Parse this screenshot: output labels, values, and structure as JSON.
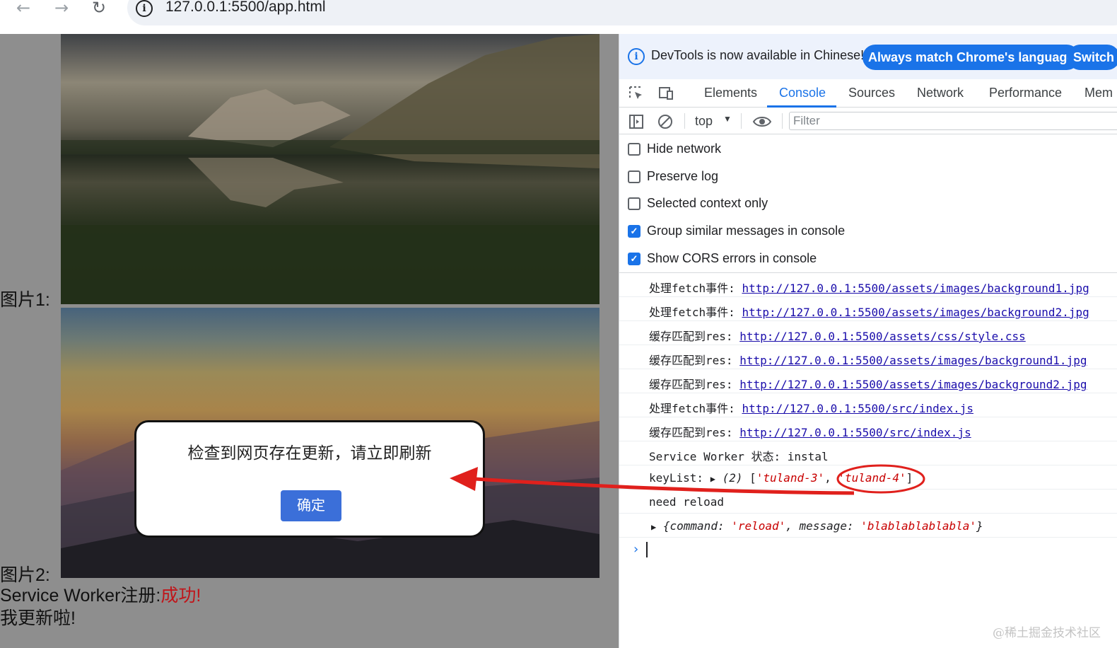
{
  "browser": {
    "url": "127.0.0.1:5500/app.html",
    "back_icon": "back-arrow-icon",
    "forward_icon": "forward-arrow-icon",
    "reload_icon": "reload-icon",
    "site_info_icon": "info-icon"
  },
  "page": {
    "image1_label": "图片1:",
    "image2_label": "图片2:",
    "sw_label": "Service Worker注册:",
    "sw_status": "成功!",
    "update_text": "我更新啦!",
    "dialog": {
      "message": "检查到网页存在更新，请立即刷新",
      "confirm": "确定"
    }
  },
  "devtools": {
    "infobar": {
      "text": "DevTools is now available in Chinese!",
      "match_button": "Always match Chrome's language",
      "switch_button": "Switch"
    },
    "tabs": [
      "Elements",
      "Console",
      "Sources",
      "Network",
      "Performance",
      "Mem"
    ],
    "active_tab": "Console",
    "context": "top",
    "filter_placeholder": "Filter",
    "settings": [
      {
        "label": "Hide network",
        "checked": false
      },
      {
        "label": "Preserve log",
        "checked": false
      },
      {
        "label": "Selected context only",
        "checked": false
      },
      {
        "label": "Group similar messages in console",
        "checked": true
      },
      {
        "label": "Show CORS errors in console",
        "checked": true
      }
    ],
    "logs": [
      {
        "prefix": "处理fetch事件:",
        "link": "http://127.0.0.1:5500/assets/images/background1.jpg"
      },
      {
        "prefix": "处理fetch事件:",
        "link": "http://127.0.0.1:5500/assets/images/background2.jpg"
      },
      {
        "prefix": "缓存匹配到res:",
        "link": "http://127.0.0.1:5500/assets/css/style.css"
      },
      {
        "prefix": "缓存匹配到res:",
        "link": "http://127.0.0.1:5500/assets/images/background1.jpg"
      },
      {
        "prefix": "缓存匹配到res:",
        "link": "http://127.0.0.1:5500/assets/images/background2.jpg"
      },
      {
        "prefix": "处理fetch事件:",
        "link": "http://127.0.0.1:5500/src/index.js"
      },
      {
        "prefix": "缓存匹配到res:",
        "link": "http://127.0.0.1:5500/src/index.js"
      }
    ],
    "sw_state": {
      "label": "Service Worker 状态:",
      "value": "instal"
    },
    "keylist": {
      "label": "keyList:",
      "count": "(2)",
      "item1": "'tuland-3'",
      "item2": "'tuland-4'"
    },
    "need_reload": "need reload",
    "object": {
      "key1": "command",
      "val1": "'reload'",
      "key2": "message",
      "val2": "'blablablablabla'"
    },
    "prompt": "›"
  },
  "annotation": {
    "color": "#e0201c"
  },
  "watermark": "@稀土掘金技术社区"
}
